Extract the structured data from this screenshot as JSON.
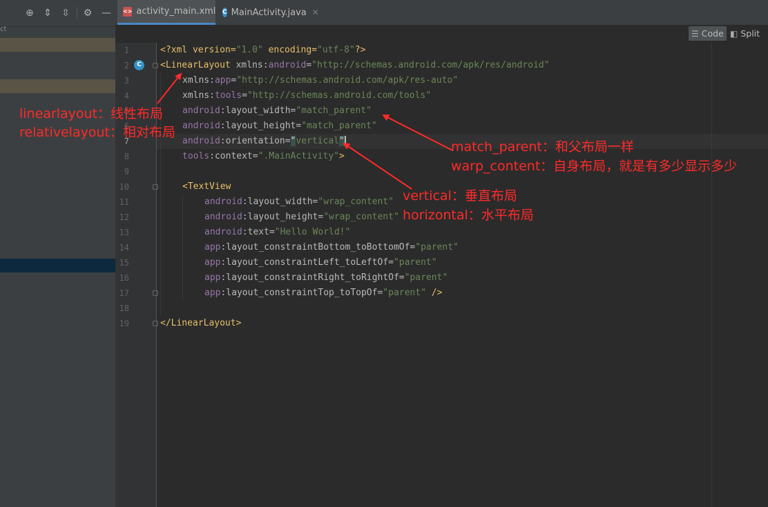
{
  "left_panel": {
    "project_label": "ct",
    "toolbar_icons": [
      "crosshair-icon",
      "expand-all-icon",
      "collapse-all-icon",
      "gear-icon",
      "minimize-icon"
    ]
  },
  "tabs": [
    {
      "label": "activity_main.xml",
      "icon": "xml-file-icon",
      "active": true
    },
    {
      "label": "MainActivity.java",
      "icon": "java-class-icon",
      "active": false
    }
  ],
  "view_modes": {
    "code_label": "Code",
    "split_label": "Split"
  },
  "editor": {
    "current_line": 7,
    "line_numbers": [
      "1",
      "2",
      "3",
      "4",
      "5",
      "6",
      "7",
      "8",
      "9",
      "10",
      "11",
      "12",
      "13",
      "14",
      "15",
      "16",
      "17",
      "18",
      "19"
    ],
    "lines": {
      "l1": {
        "a": "<?xml version=",
        "b": "\"1.0\"",
        "c": " encoding=",
        "d": "\"utf-8\"",
        "e": "?>"
      },
      "l2": {
        "open": "<",
        "tag": "LinearLayout",
        "sp": " xmlns:",
        "ns": "android",
        "eq": "=",
        "val": "\"http://schemas.android.com/apk/res/android\""
      },
      "l3": {
        "pre": "xmlns:",
        "ns": "app",
        "eq": "=",
        "val": "\"http://schemas.android.com/apk/res-auto\""
      },
      "l4": {
        "pre": "xmlns:",
        "ns": "tools",
        "eq": "=",
        "val": "\"http://schemas.android.com/tools\""
      },
      "l5": {
        "ns": "android",
        "attr": ":layout_width",
        "eq": "=",
        "val": "\"match_parent\""
      },
      "l6": {
        "ns": "android",
        "attr": ":layout_height",
        "eq": "=",
        "val": "\"match_parent\""
      },
      "l7": {
        "ns": "android",
        "attr": ":orientation",
        "eq": "=",
        "q1": "\"",
        "val": "vertical",
        "q2": "\""
      },
      "l8": {
        "ns": "tools",
        "attr": ":context",
        "eq": "=",
        "val": "\".MainActivity\"",
        "close": ">"
      },
      "l10": {
        "open": "<",
        "tag": "TextView"
      },
      "l11": {
        "ns": "android",
        "attr": ":layout_width",
        "eq": "=",
        "val": "\"wrap_content\""
      },
      "l12": {
        "ns": "android",
        "attr": ":layout_height",
        "eq": "=",
        "val": "\"wrap_content\""
      },
      "l13": {
        "ns": "android",
        "attr": ":text",
        "eq": "=",
        "val": "\"Hello World!\""
      },
      "l14": {
        "ns": "app",
        "attr": ":layout_constraintBottom_toBottomOf",
        "eq": "=",
        "val": "\"parent\""
      },
      "l15": {
        "ns": "app",
        "attr": ":layout_constraintLeft_toLeftOf",
        "eq": "=",
        "val": "\"parent\""
      },
      "l16": {
        "ns": "app",
        "attr": ":layout_constraintRight_toRightOf",
        "eq": "=",
        "val": "\"parent\""
      },
      "l17": {
        "ns": "app",
        "attr": ":layout_constraintTop_toTopOf",
        "eq": "=",
        "val": "\"parent\"",
        "close": " />"
      },
      "l19": {
        "close": "</",
        "tag": "LinearLayout",
        "end": ">"
      }
    }
  },
  "annotations": {
    "linear": "linearlayout：线性布局",
    "relative": "relativelayout：相对布局",
    "match_parent": "match_parent：和父布局一样",
    "wrap_content": "warp_content：自身布局，就是有多少显示多少",
    "vertical": "vertical：垂直布局",
    "horizontal": "horizontal：水平布局",
    "color": "#ff2a2a"
  }
}
